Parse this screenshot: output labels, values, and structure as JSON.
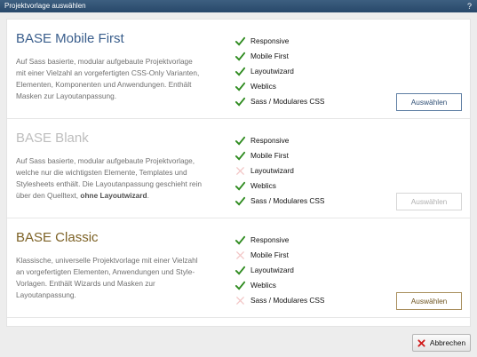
{
  "window": {
    "title": "Projektvorlage auswählen",
    "help_label": "?"
  },
  "colors": {
    "titlebar": "#2f5072",
    "check": "#2e8b1f",
    "cross": "#f2c6c6"
  },
  "templates": [
    {
      "title": "BASE Mobile First",
      "description": "Auf Sass basierte, modular aufgebaute Projektvorlage mit einer Vielzahl an vorgefertigten CSS-Only Varianten, Elementen, Komponenten und Anwendungen. Enthält Masken zur Layoutanpassung.",
      "description_bold": "",
      "description_end": "",
      "features": [
        {
          "label": "Responsive",
          "included": true,
          "icon": "check-icon"
        },
        {
          "label": "Mobile First",
          "included": true,
          "icon": "check-icon"
        },
        {
          "label": "Layoutwizard",
          "included": true,
          "icon": "check-icon"
        },
        {
          "label": "Weblics",
          "included": true,
          "icon": "check-icon"
        },
        {
          "label": "Sass / Modulares CSS",
          "included": true,
          "icon": "check-icon"
        }
      ],
      "select_label": "Auswählen",
      "enabled": true
    },
    {
      "title": "BASE Blank",
      "description": "Auf Sass basierte, modular aufgebaute Projektvorlage, welche nur die wichtigsten Elemente, Templates und Stylesheets enthält. Die Layoutanpassung geschieht rein über den Quelltext, ",
      "description_bold": "ohne Layoutwizard",
      "description_end": ".",
      "features": [
        {
          "label": "Responsive",
          "included": true,
          "icon": "check-icon"
        },
        {
          "label": "Mobile First",
          "included": true,
          "icon": "check-icon"
        },
        {
          "label": "Layoutwizard",
          "included": false,
          "icon": "cross-icon"
        },
        {
          "label": "Weblics",
          "included": true,
          "icon": "check-icon"
        },
        {
          "label": "Sass / Modulares CSS",
          "included": true,
          "icon": "check-icon"
        }
      ],
      "select_label": "Auswählen",
      "enabled": false
    },
    {
      "title": "BASE Classic",
      "description": "Klassische, universelle Projektvorlage mit einer Vielzahl an vorgefertigten Elementen, Anwendungen und Style-Vorlagen. Enthält Wizards und Masken zur Layoutanpassung.",
      "description_bold": "",
      "description_end": "",
      "features": [
        {
          "label": "Responsive",
          "included": true,
          "icon": "check-icon"
        },
        {
          "label": "Mobile First",
          "included": false,
          "icon": "cross-icon"
        },
        {
          "label": "Layoutwizard",
          "included": true,
          "icon": "check-icon"
        },
        {
          "label": "Weblics",
          "included": true,
          "icon": "check-icon"
        },
        {
          "label": "Sass / Modulares CSS",
          "included": false,
          "icon": "cross-icon"
        }
      ],
      "select_label": "Auswählen",
      "enabled": true
    }
  ],
  "footer": {
    "cancel_label": "Abbrechen",
    "cancel_icon": "close-icon"
  }
}
